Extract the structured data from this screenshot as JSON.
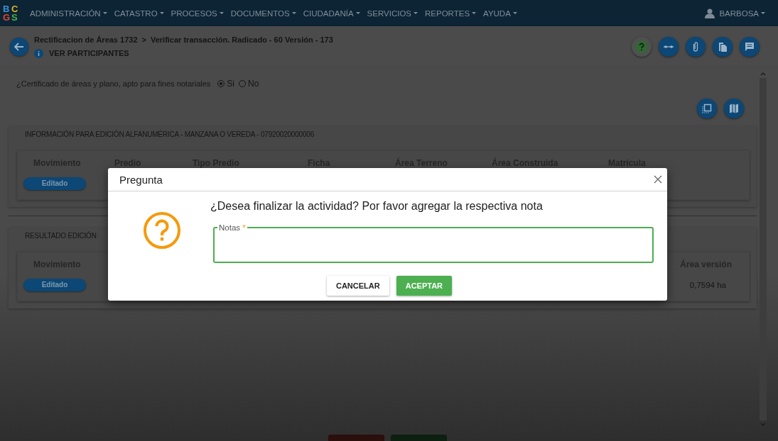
{
  "navbar": {
    "logo": "BCGS",
    "menu": [
      {
        "label": "ADMINISTRACIÓN"
      },
      {
        "label": "CATASTRO"
      },
      {
        "label": "PROCESOS"
      },
      {
        "label": "DOCUMENTOS"
      },
      {
        "label": "CIUDADANÍA"
      },
      {
        "label": "SERVICIOS"
      },
      {
        "label": "REPORTES"
      },
      {
        "label": "AYUDA"
      }
    ],
    "user": "BARBOSA"
  },
  "header": {
    "breadcrumb": [
      "Rectificacion de Áreas 1732",
      "Verificar transacción. Radicado - 60 Versión - 173"
    ],
    "separator": ">",
    "link": "VER PARTICIPANTES",
    "actions": [
      {
        "kind": "help"
      },
      {
        "kind": "connect"
      },
      {
        "kind": "attach"
      },
      {
        "kind": "copy"
      },
      {
        "kind": "notes"
      }
    ]
  },
  "certificate": {
    "question": "¿Certificado de áreas y plano, apto para fines notariales",
    "options": [
      {
        "label": "Si",
        "selected": true
      },
      {
        "label": "No",
        "selected": false
      }
    ]
  },
  "tools": [
    {
      "kind": "select"
    },
    {
      "kind": "map"
    }
  ],
  "tables": [
    {
      "title": "INFORMACIÓN PARA EDICIÓN ALFANUMÉRICA - MANZANA O VEREDA - 07920020000006",
      "columns": [
        "Movimiento",
        "Predio",
        "Tipo Predio",
        "Ficha",
        "Área Terreno",
        "Área Construida",
        "Matrícula"
      ],
      "rows": [
        {
          "cells": [
            {
              "kind": "badge",
              "text": "Editado"
            }
          ]
        }
      ]
    },
    {
      "title": "RESULTADO EDICIÓN",
      "columns": [
        "Movimiento",
        "Área versión"
      ],
      "rows": [
        {
          "cells": [
            {
              "kind": "badge",
              "text": "Editado"
            },
            {
              "kind": "text",
              "text": "0,7594 ha"
            }
          ]
        }
      ]
    }
  ],
  "footer_buttons": [
    {
      "kind": "danger"
    },
    {
      "kind": "success"
    }
  ],
  "dialog": {
    "title": "Pregunta",
    "message": "¿Desea finalizar la actividad? Por favor agregar la respectiva nota",
    "field": {
      "label": "Notas",
      "required_mark": "*",
      "focused": true
    },
    "buttons": [
      {
        "label": "CANCELAR",
        "kind": "secondary"
      },
      {
        "label": "ACEPTAR",
        "kind": "primary"
      }
    ]
  }
}
